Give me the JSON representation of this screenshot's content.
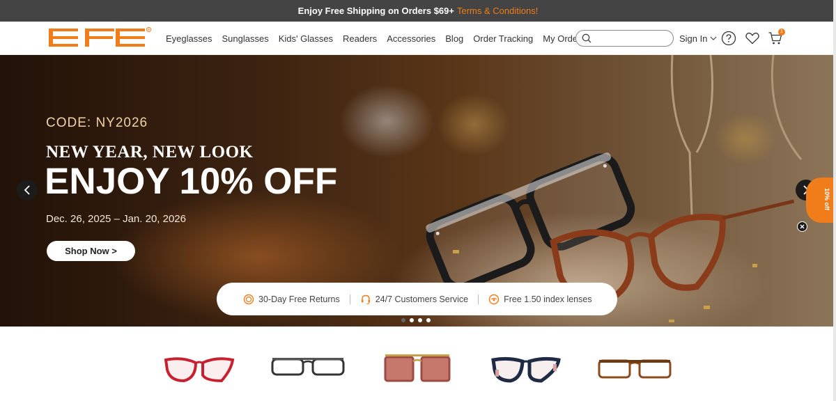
{
  "topbar": {
    "message": "Enjoy Free Shipping on Orders $69+",
    "terms_link": "Terms & Conditions!"
  },
  "header": {
    "logo_text": "EFE",
    "logo_mark": "®",
    "nav": [
      "Eyeglasses",
      "Sunglasses",
      "Kids' Glasses",
      "Readers",
      "Accessories",
      "Blog",
      "Order Tracking",
      "My Orders"
    ],
    "search_placeholder": "",
    "signin_label": "Sign In",
    "cart_count": "1",
    "icons": [
      "search-icon",
      "chevron-down-icon",
      "help-icon",
      "heart-icon",
      "cart-icon"
    ]
  },
  "hero": {
    "code": "CODE: NY2026",
    "headline1": "NEW YEAR,  NEW LOOK",
    "headline2": "ENJOY 10% OFF",
    "dates": "Dec. 26, 2025 – Jan. 20, 2026",
    "cta": "Shop Now >",
    "features": [
      {
        "icon": "return-icon",
        "label": "30-Day Free Returns"
      },
      {
        "icon": "headset-icon",
        "label": "24/7 Customers Service"
      },
      {
        "icon": "lens-icon",
        "label": "Free 1.50 index lenses"
      }
    ],
    "slides_total": 4,
    "active_slide": 1,
    "side_tab": "10% off"
  },
  "products": [
    {
      "name": "red-cat-eye-frame",
      "color": "#c8202e"
    },
    {
      "name": "black-rectangle-frame",
      "color": "#333333"
    },
    {
      "name": "pink-square-sunglasses",
      "color": "#9b4a44"
    },
    {
      "name": "navy-pink-frame",
      "color": "#1f2a44"
    },
    {
      "name": "tortoise-rectangle-frame",
      "color": "#8a4a1c"
    }
  ],
  "colors": {
    "brand": "#f07c1a",
    "topbar_bg": "#444444"
  }
}
